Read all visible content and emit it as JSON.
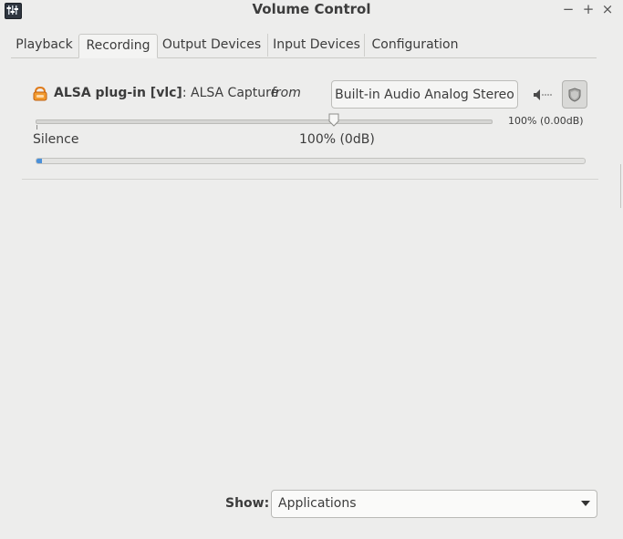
{
  "window": {
    "title": "Volume Control",
    "minimize": "−",
    "maximize": "+",
    "close": "×"
  },
  "tabs": [
    {
      "label": "Playback"
    },
    {
      "label": "Recording"
    },
    {
      "label": "Output Devices"
    },
    {
      "label": "Input Devices"
    },
    {
      "label": "Configuration"
    }
  ],
  "active_tab": "Recording",
  "stream": {
    "name": "ALSA plug-in [vlc]",
    "separator": ": ",
    "description": "ALSA Capture",
    "from_label": "from",
    "device": "Built-in Audio Analog Stereo",
    "volume_readout": "100% (0.00dB)",
    "volume_percent": 100,
    "scale_min_label": "Silence",
    "scale_mark_label": "100% (0dB)",
    "level_fraction": 0.01,
    "mute_icon": "speaker-muted-icon",
    "lock_icon": "lock-channels-icon"
  },
  "footer": {
    "show_label": "Show:",
    "show_value": "Applications"
  },
  "colors": {
    "background": "#ededec",
    "accent": "#4a90d9",
    "stream_icon": "#e07b1a"
  }
}
